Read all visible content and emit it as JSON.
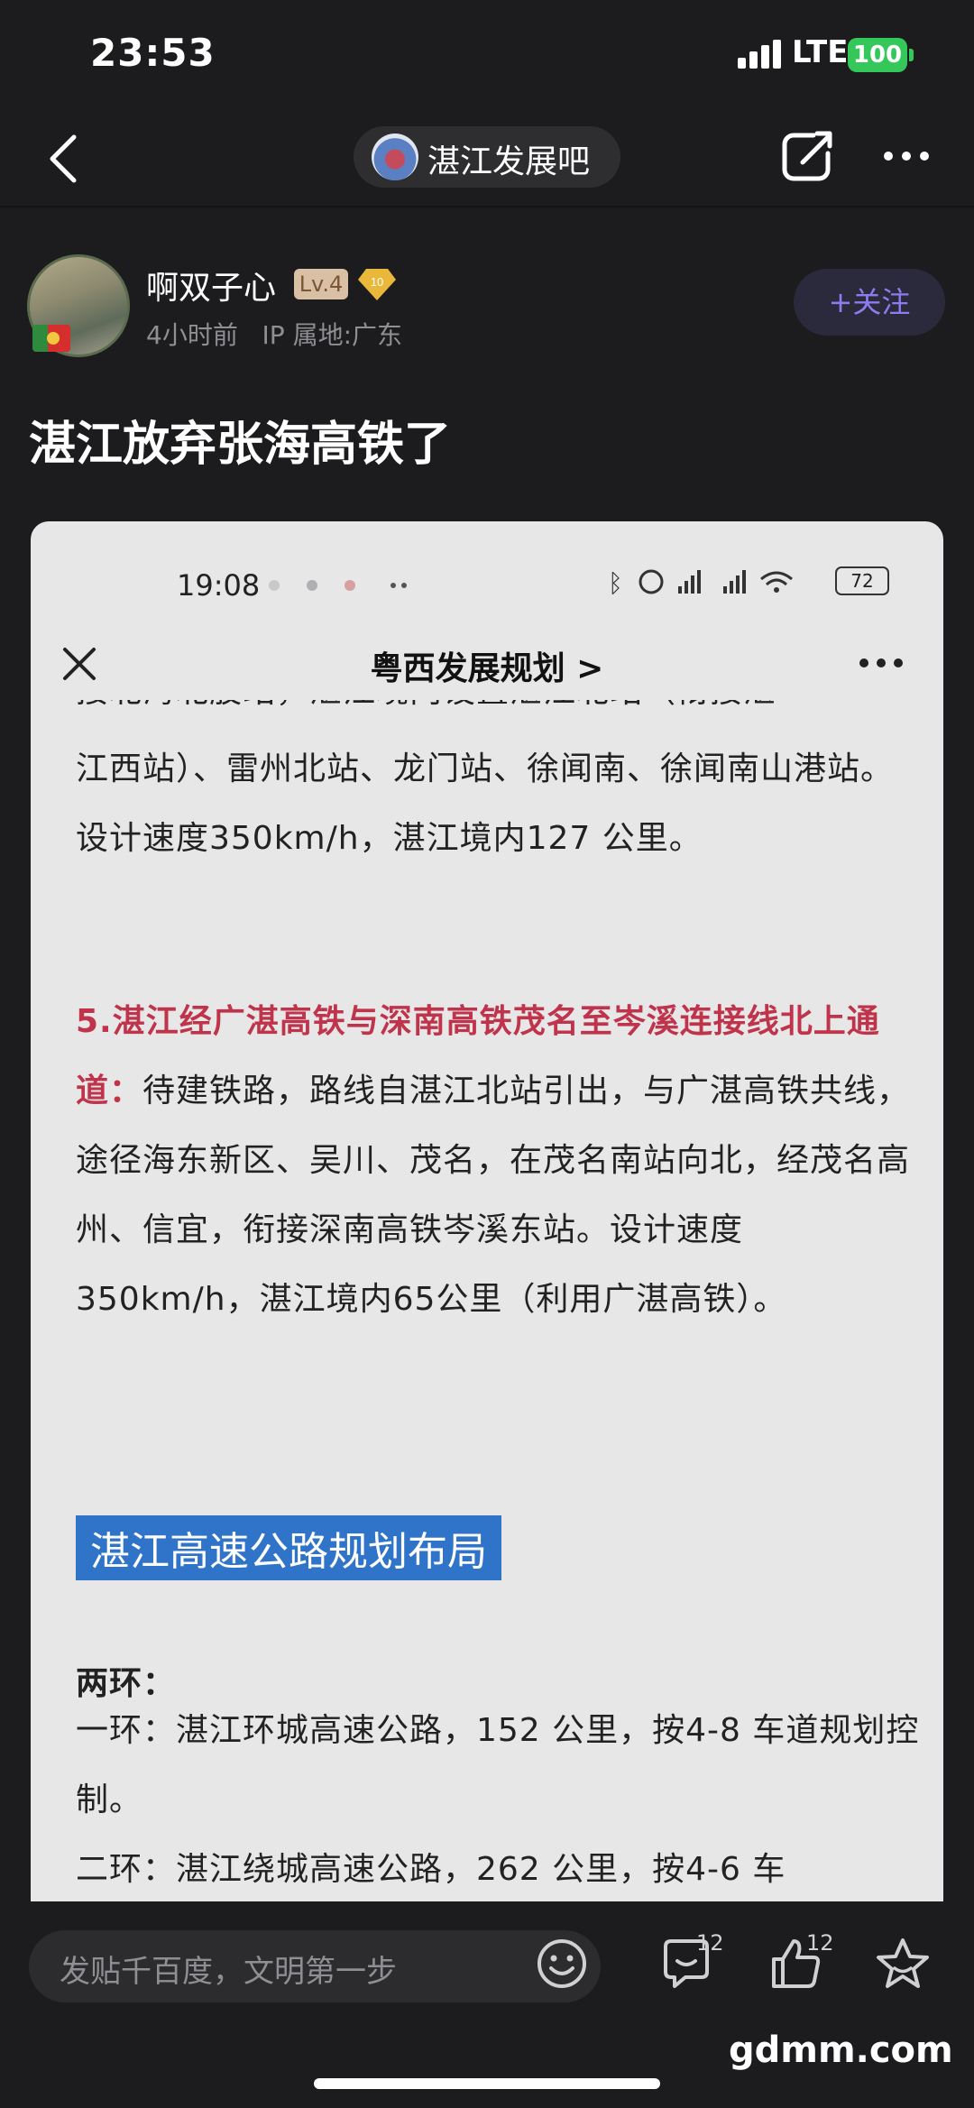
{
  "status_bar": {
    "time": "23:53",
    "network": "LTE",
    "battery": "100"
  },
  "nav": {
    "forum_name": "湛江发展吧"
  },
  "author": {
    "name": "啊双子心",
    "level": "Lv.4",
    "badge": "10",
    "time_ago": "4小时前",
    "ip_location": "IP 属地:广东",
    "follow_label": "+关注"
  },
  "post": {
    "title": "湛江放弃张海高铁了"
  },
  "screenshot": {
    "status_time": "19:08",
    "status_battery": "72",
    "title": "粤西发展规划 >",
    "cut_line": "接北海北股站，湛江境内设置湛江北站（衔接湛",
    "para1": "江西站）、雷州北站、龙门站、徐闻南、徐闻南山港站。设计速度350km/h，湛江境内127 公里。",
    "para2_red": "5.湛江经广湛高铁与深南高铁茂名至岑溪连接线北上通道：",
    "para2_rest": "待建铁路，路线自湛江北站引出，与广湛高铁共线，途径海东新区、吴川、茂名，在茂名南站向北，经茂名高州、信宜，衔接深南高铁岑溪东站。设计速度350km/h，湛江境内65公里（利用广湛高铁）。",
    "section_heading": "湛江高速公路规划布局",
    "subhead": "两环：",
    "line1": "一环：湛江环城高速公路，152 公里，按4-8 车道规划控制。",
    "line2": "二环：湛江绕城高速公路，262 公里，按4-6 车"
  },
  "bottom_bar": {
    "comment_placeholder": "发贴千百度，文明第一步",
    "comment_count": "12",
    "like_count": "12"
  },
  "watermark": "gdmm.com"
}
